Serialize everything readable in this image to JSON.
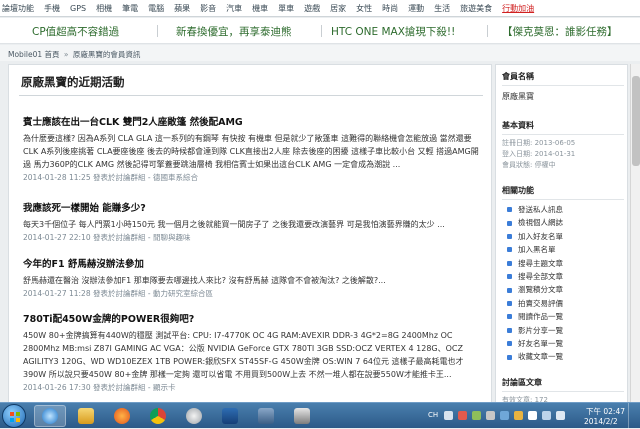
{
  "topnav": {
    "items": [
      "論壇功能",
      "手機",
      "GPS",
      "相機",
      "筆電",
      "電腦",
      "蘋果",
      "影音",
      "汽車",
      "機車",
      "單車",
      "遊戲",
      "居家",
      "女性",
      "時尚",
      "運動",
      "生活",
      "旅遊美食"
    ],
    "highlight": "行動加油"
  },
  "banner": {
    "promos": [
      "CP值超高不容錯過",
      "新春換優宜，再享泰迪熊",
      "HTC ONE MAX搶現下殺!!",
      "【傑克莫恩：誰影任務】"
    ]
  },
  "breadcrumb": {
    "home": "Mobile01 首頁",
    "separator": "»",
    "current": "原廠黑寶的會員資訊"
  },
  "main": {
    "title": "原廠黑寶的近期活動",
    "articles": [
      {
        "title": "賓士應該在出一台CLK 雙門2人座敞篷 然後配AMG",
        "body": "為什麼要這樣? 因為A系列 CLA GLA 這一系列的有鋼琴 有快按 有機車 但是就少了敞篷車 這難得的聯絡機會怎能放過 當然還要CLK A系列後座挑著 CLA要座後座 後去的時候都會達到隊 CLK直接出2人座 除去後座的困擾 這樣子車比較小台 又輕 搭過AMG開過 馬力360P的CLK AMG 然後記得可擎蓋要跳油層椅 我相信賓士如果出這台CLK AMG 一定會成為潮說 ...",
        "meta": "2014-01-28 11:25 發表於討論群組 - ",
        "group": "德國車系綜合"
      },
      {
        "title": "我應該死一樣開始 能賺多少?",
        "body": "每天3千個位子 每人門票1小時150元 我一個月之後就能買一間房子了 之後我還要改演藝界 可是我怕演藝界賺的太少 ...",
        "meta": "2014-01-27 22:10 發表於討論群組 - ",
        "group": "閒聊與趣味"
      },
      {
        "title": "今年的F1 舒馬赫沒辦法參加",
        "body": "舒馬赫還在醫治 沒辦法參加F1 那車隊要去哪邊找人來比? 沒有舒馬赫 這隊會不會被淘汰? 之後解散?...",
        "meta": "2014-01-27 11:28 發表於討論群組 - ",
        "group": "動力研究室綜合區"
      },
      {
        "title": "780Ti配450W金牌的POWER很夠吧?",
        "body": "450W 80+金牌搞算有440W的穩壓 測試平台: CPU: I7-4770K OC 4G RAM:AVEXIR DDR-3 4G*2=8G 2400Mhz OC 2800Mhz MB:msi Z87I GAMING AC VGA：公版 NVIDIA GeForce GTX 780TI 3GB SSD:OCZ VERTEX 4 128G、OCZ AGILITY3 120G、WD WD10EZEX 1TB POWER:銀欣SFX ST45SF-G 450W金牌 OS:WIN 7 64位元 這樣子最高耗電也才390W 所以說只要450W 80+金牌 那樣一定夠 還可以省電 不用買到500W上去 不然一堆人都在說要550W才能推卡王...",
        "meta": "2014-01-26 17:30 發表於討論群組 - ",
        "group": "顯示卡"
      }
    ]
  },
  "side": {
    "name_heading": "會員名稱",
    "name": "原廠黑寶",
    "info_heading": "基本資料",
    "info": [
      "註冊日期: 2013-06-05",
      "登入日期: 2014-01-31",
      "會員狀態: 停權中"
    ],
    "func_heading": "相關功能",
    "funcs": [
      "發送私人訊息",
      "檢視個人網誌",
      "加入好友名單",
      "加入黑名單",
      "搜尋主題文章",
      "搜尋全部文章",
      "瀏覽積分文章",
      "拍賣交易評價",
      "閱讀作品一覽",
      "影片分享一覽",
      "好友名單一覽",
      "收藏文章一覽"
    ],
    "forum_heading": "討論區文章",
    "forum_stat": "有效文章: 172"
  },
  "taskbar": {
    "lang": "CH",
    "time": "下午 02:47",
    "date": "2014/2/2"
  }
}
